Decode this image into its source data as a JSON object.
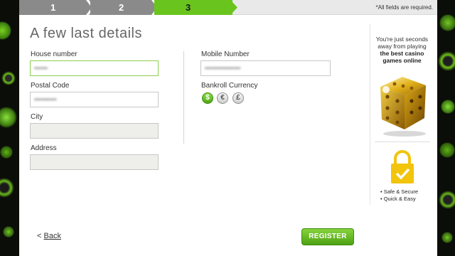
{
  "steps": [
    {
      "label": "1"
    },
    {
      "label": "2"
    },
    {
      "label": "3"
    }
  ],
  "required_note": "*All fields are required.",
  "title": "A few last details",
  "form": {
    "house_number": {
      "label": "House number",
      "value": "••••••"
    },
    "postal_code": {
      "label": "Postal Code",
      "value": "••••••••••"
    },
    "city": {
      "label": "City",
      "value": ""
    },
    "address": {
      "label": "Address",
      "value": ""
    },
    "mobile_number": {
      "label": "Mobile Number",
      "value": "••••••••••••••••"
    },
    "bankroll_currency": {
      "label": "Bankroll Currency",
      "options": [
        "$",
        "€",
        "£"
      ],
      "selected": "$"
    }
  },
  "promo": {
    "line1": "You're just seconds",
    "line2": "away from playing",
    "highlight1": "the best casino",
    "highlight2": "games online",
    "features": [
      "• Safe & Secure",
      "• Quick & Easy"
    ]
  },
  "back_label": "Back",
  "register_label": "REGISTER",
  "colors": {
    "accent": "#69c51d",
    "step_inactive": "#8a8a8a",
    "lock": "#f2c40c"
  }
}
